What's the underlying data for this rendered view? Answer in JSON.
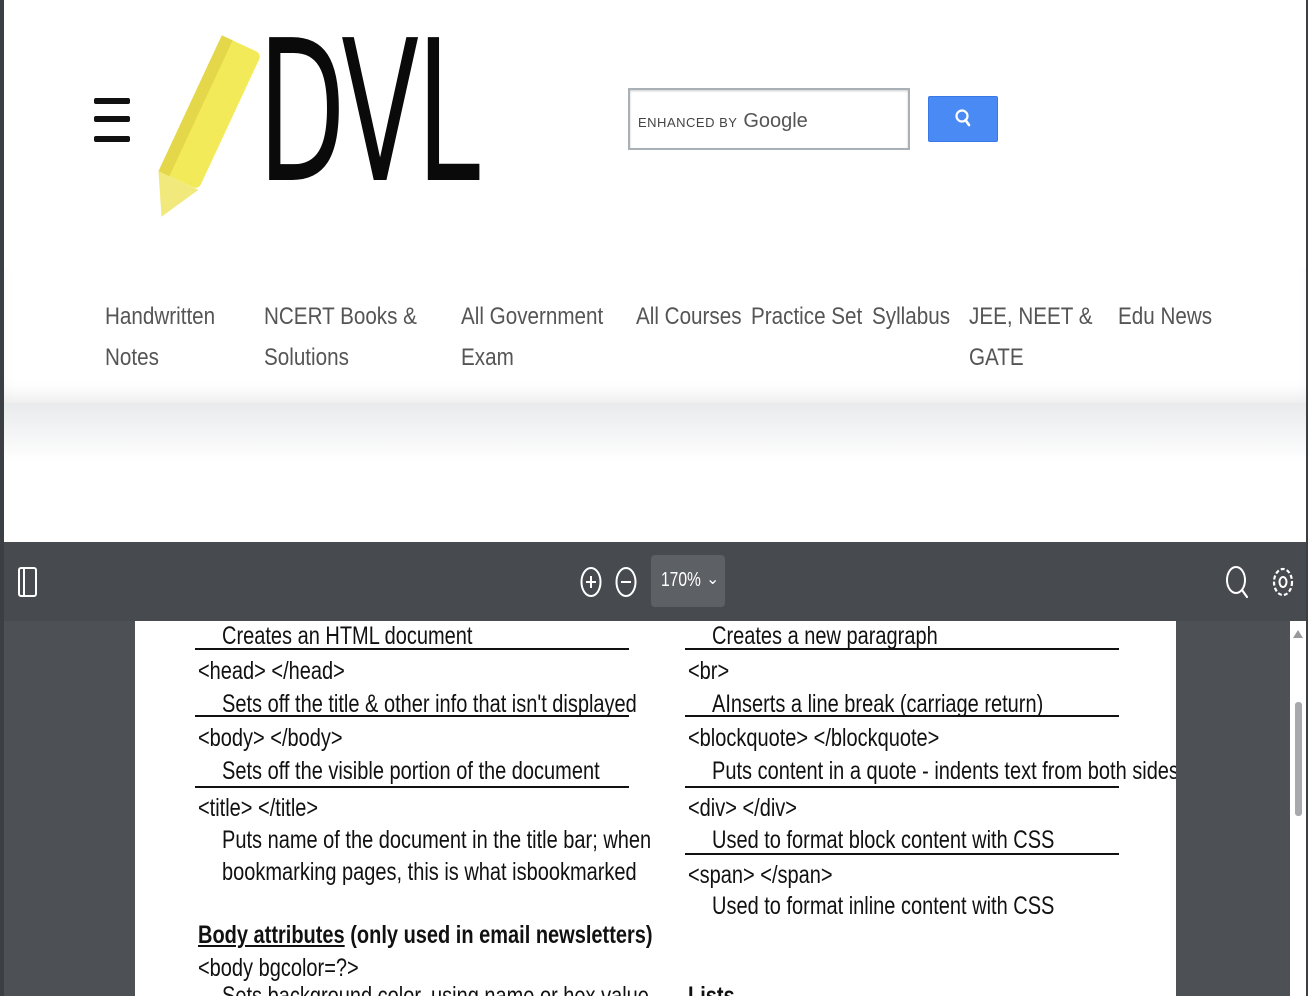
{
  "header": {
    "logo_text": "DVL",
    "search": {
      "enhanced_label": "ENHANCED BY",
      "provider": "Google",
      "button_icon": "search-icon"
    }
  },
  "nav": {
    "items": [
      {
        "line1": "Handwritten",
        "line2": "Notes"
      },
      {
        "line1": "NCERT Books &",
        "line2": "Solutions"
      },
      {
        "line1": "All Government",
        "line2": "Exam"
      },
      {
        "line1": "All Courses",
        "line2": ""
      },
      {
        "line1": "Practice Set",
        "line2": ""
      },
      {
        "line1": "Syllabus",
        "line2": ""
      },
      {
        "line1": "JEE, NEET &",
        "line2": "GATE"
      },
      {
        "line1": "Edu News",
        "line2": ""
      }
    ]
  },
  "pdf_viewer": {
    "zoom": "170%",
    "colors": {
      "toolbar": "#474a4e",
      "background": "#4d5155"
    }
  },
  "document": {
    "left_column": {
      "line1": "Creates an HTML document",
      "line2": "<head> </head>",
      "line3": "Sets off the title & other info that isn't displayed",
      "line4": "<body> </body>",
      "line5": "Sets off the visible portion of the document",
      "line6": "<title> </title>",
      "line7": "Puts name of the document in the title bar; when",
      "line8": "bookmarking pages, this is what isbookmarked",
      "heading_underlined": "Body attributes",
      "heading_rest": " (only used in email newsletters)",
      "line9": "<body bgcolor=?>",
      "line10": "Sets background color, using name or hex value"
    },
    "right_column": {
      "line1": "Creates a new paragraph",
      "line2": "<br>",
      "line3": "AInserts a line break (carriage return)",
      "line4": "<blockquote> </blockquote>",
      "line5": "Puts content in a quote - indents text from both sides",
      "line6": "<div> </div>",
      "line7": "Used to format block content with CSS",
      "line8": "<span> </span>",
      "line9": "Used to format inline content with CSS",
      "line10": "Lists"
    }
  }
}
